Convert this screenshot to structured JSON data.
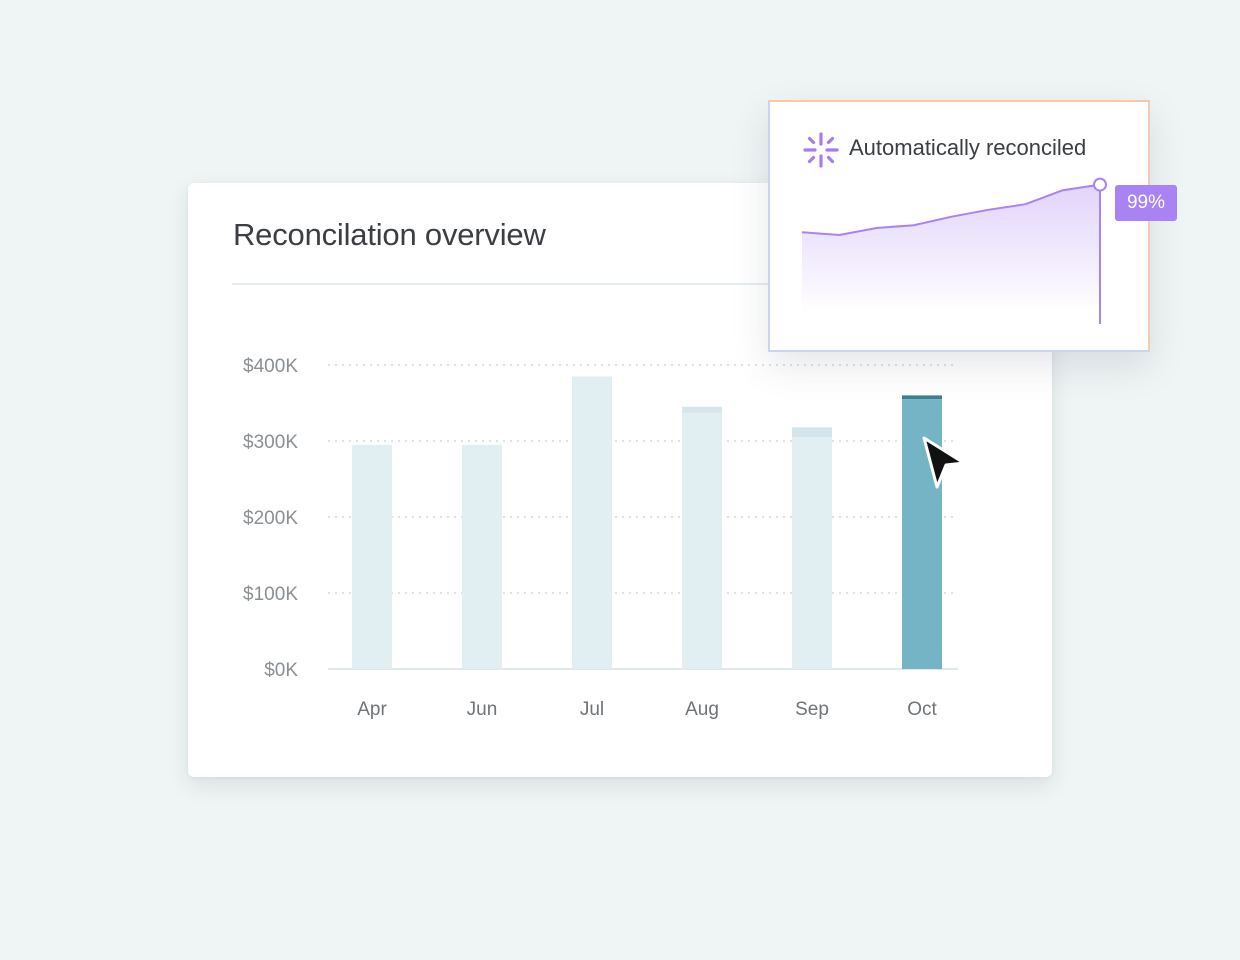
{
  "card": {
    "title": "Reconcilation overview"
  },
  "chart_data": {
    "type": "bar",
    "title": "Reconcilation overview",
    "categories": [
      "Apr",
      "Jun",
      "Jul",
      "Aug",
      "Sep",
      "Oct"
    ],
    "values": [
      295000,
      295000,
      385000,
      345000,
      318000,
      360000
    ],
    "inner_values": [
      295000,
      295000,
      385000,
      337000,
      305000,
      355000
    ],
    "highlighted_category": "Oct",
    "y_ticks": [
      "$0K",
      "$100K",
      "$200K",
      "$300K",
      "$400K"
    ],
    "ylim": [
      0,
      400000
    ],
    "grid": "horizontal dotted",
    "colors": {
      "bar": "#e1eef2",
      "bar_cap": "#d4e6ec",
      "highlight": "#74b4c4",
      "highlight_cap": "#3b8193",
      "grid": "#cfd8dc"
    }
  },
  "popup": {
    "title": "Automatically reconciled",
    "badge": "99%",
    "icon": "sparkle-asterisk-icon",
    "accent_color": "#a982f3",
    "trend": [
      0.52,
      0.5,
      0.55,
      0.57,
      0.63,
      0.68,
      0.72,
      0.82,
      0.86
    ]
  },
  "cursor": {
    "icon": "arrow-pointer-icon"
  }
}
